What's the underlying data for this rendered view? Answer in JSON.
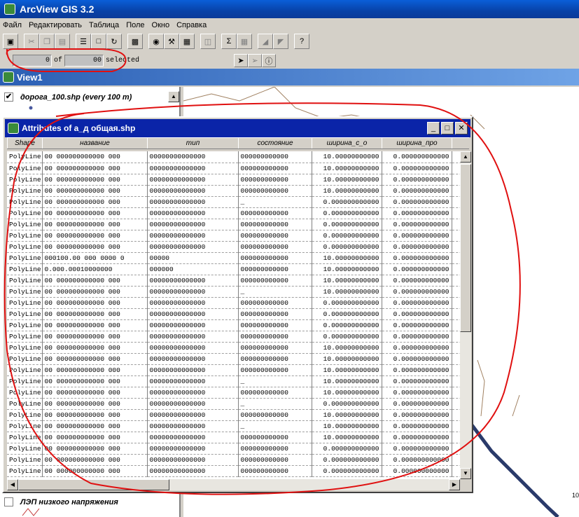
{
  "app": {
    "title": "ArcView GIS 3.2"
  },
  "menu": [
    "Файл",
    "Редактировать",
    "Таблица",
    "Поле",
    "Окно",
    "Справка"
  ],
  "selection": {
    "selected_count": "0",
    "of_label": "of",
    "total": "00",
    "selected_label": "selected"
  },
  "view": {
    "title": "View1"
  },
  "toc": {
    "layer1": {
      "name": "дорога_100.shp (every 100 m)",
      "checked": true
    },
    "layer2": {
      "name": "ЛЭП низкого напряжения",
      "checked": false
    }
  },
  "attr_window": {
    "title": "Attributes of а_д общая.shp"
  },
  "table": {
    "columns": [
      "Shape",
      "название",
      "тип",
      "состояние",
      "ширина_с_о",
      "ширина_про"
    ],
    "rows": [
      [
        "PolyLine",
        "00 000000000000 000",
        "00000000000000",
        "000000000000",
        "10.00000000000",
        "0.000000000000"
      ],
      [
        "PolyLine",
        "00 000000000000 000",
        "00000000000000",
        "000000000000",
        "10.00000000000",
        "0.000000000000"
      ],
      [
        "PolyLine",
        "00 000000000000 000",
        "00000000000000",
        "000000000000",
        "10.00000000000",
        "0.000000000000"
      ],
      [
        "PolyLine",
        "00 000000000000 000",
        "00000000000000",
        "000000000000",
        "10.00000000000",
        "0.000000000000"
      ],
      [
        "PolyLine",
        "00 000000000000 000",
        "00000000000000",
        "_",
        "0.000000000000",
        "0.000000000000"
      ],
      [
        "PolyLine",
        "00 000000000000 000",
        "00000000000000",
        "000000000000",
        "0.000000000000",
        "0.000000000000"
      ],
      [
        "PolyLine",
        "00 000000000000 000",
        "00000000000000",
        "000000000000",
        "0.000000000000",
        "0.000000000000"
      ],
      [
        "PolyLine",
        "00 000000000000 000",
        "00000000000000",
        "000000000000",
        "0.000000000000",
        "0.000000000000"
      ],
      [
        "PolyLine",
        "00 000000000000 000",
        "00000000000000",
        "000000000000",
        "0.000000000000",
        "0.000000000000"
      ],
      [
        "PolyLine",
        "000100.00 000 0000 0",
        "00000",
        "000000000000",
        "10.00000000000",
        "0.000000000000"
      ],
      [
        "PolyLine",
        "0.000.00010000000",
        "000000",
        "000000000000",
        "10.00000000000",
        "0.000000000000"
      ],
      [
        "PolyLine",
        "00 000000000000 000",
        "00000000000000",
        "000000000000",
        "10.00000000000",
        "0.000000000000"
      ],
      [
        "PolyLine",
        "00 000000000000 000",
        "00000000000000",
        "_",
        "10.00000000000",
        "0.000000000000"
      ],
      [
        "PolyLine",
        "00 000000000000 000",
        "00000000000000",
        "000000000000",
        "0.000000000000",
        "0.000000000000"
      ],
      [
        "PolyLine",
        "00 000000000000 000",
        "00000000000000",
        "000000000000",
        "0.000000000000",
        "0.000000000000"
      ],
      [
        "PolyLine",
        "00 000000000000 000",
        "00000000000000",
        "000000000000",
        "0.000000000000",
        "0.000000000000"
      ],
      [
        "PolyLine",
        "00 000000000000 000",
        "00000000000000",
        "000000000000",
        "0.000000000000",
        "0.000000000000"
      ],
      [
        "PolyLine",
        "00 000000000000 000",
        "00000000000000",
        "000000000000",
        "10.00000000000",
        "0.000000000000"
      ],
      [
        "PolyLine",
        "00 000000000000 000",
        "00000000000000",
        "000000000000",
        "10.00000000000",
        "0.000000000000"
      ],
      [
        "PolyLine",
        "00 000000000000 000",
        "00000000000000",
        "000000000000",
        "10.00000000000",
        "0.000000000000"
      ],
      [
        "PolyLine",
        "00 000000000000 000",
        "00000000000000",
        "_",
        "10.00000000000",
        "0.000000000000"
      ],
      [
        "PolyLine",
        "00 000000000000 000",
        "00000000000000",
        "000000000000",
        "10.00000000000",
        "0.000000000000"
      ],
      [
        "PolyLine",
        "00 000000000000 000",
        "00000000000000",
        "_",
        "0.000000000000",
        "0.000000000000"
      ],
      [
        "PolyLine",
        "00 000000000000 000",
        "00000000000000",
        "000000000000",
        "10.00000000000",
        "0.000000000000"
      ],
      [
        "PolyLine",
        "00 000000000000 000",
        "00000000000000",
        "_",
        "10.00000000000",
        "0.000000000000"
      ],
      [
        "PolyLine",
        "00 000000000000 000",
        "00000000000000",
        "000000000000",
        "10.00000000000",
        "0.000000000000"
      ],
      [
        "PolyLine",
        "00 000000000000 000",
        "00000000000000",
        "000000000000",
        "0.000000000000",
        "0.000000000000"
      ],
      [
        "PolyLine",
        "00 000000000000 000",
        "00000000000000",
        "000000000000",
        "0.000000000000",
        "0.000000000000"
      ],
      [
        "PolyLine",
        "00 000000000000 000",
        "00000000000000",
        "000000000000",
        "0.000000000000",
        "0.000000000000"
      ]
    ]
  },
  "map": {
    "scale_label": "10"
  },
  "colors": {
    "title_blue": "#0a24a8",
    "annotation_red": "#e01010",
    "road_navy": "#2a3a6a"
  }
}
